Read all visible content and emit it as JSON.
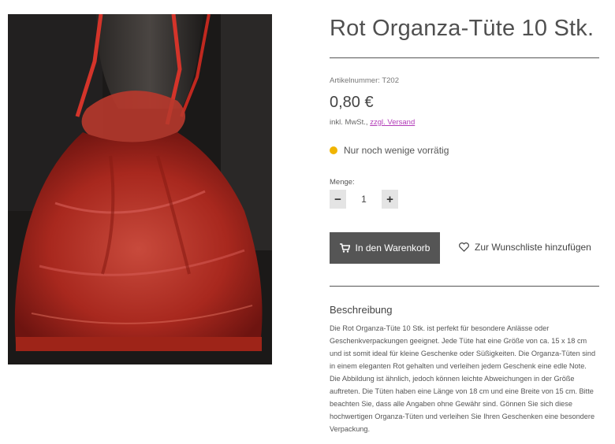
{
  "product": {
    "title": "Rot Organza-Tüte 10 Stk.",
    "sku": "Artikelnummer: T202",
    "price": "0,80 €",
    "tax_prefix": "inkl. MwSt., ",
    "shipping_link": "zzgl. Versand",
    "stock_status": "Nur noch wenige vorrätig",
    "stock_color": "#f0b400"
  },
  "quantity": {
    "label": "Menge:",
    "value": "1",
    "minus": "−",
    "plus": "+"
  },
  "actions": {
    "add_to_cart": "In den Warenkorb",
    "wishlist": "Zur Wunschliste hinzufügen"
  },
  "description": {
    "heading": "Beschreibung",
    "text": "Die Rot Organza-Tüte 10 Stk. ist perfekt für besondere Anlässe oder Geschenkverpackungen geeignet. Jede Tüte hat eine Größe von ca. 15 x 18 cm und ist somit ideal für kleine Geschenke oder Süßigkeiten. Die Organza-Tüten sind in einem eleganten Rot gehalten und verleihen jedem Geschenk eine edle Note. Die Abbildung ist ähnlich, jedoch können leichte Abweichungen in der Größe auftreten. Die Tüten haben eine Länge von 18 cm und eine Breite von 15 cm. Bitte beachten Sie, dass alle Angaben ohne Gewähr sind. Gönnen Sie sich diese hochwertigen Organza-Tüten und verleihen Sie Ihren Geschenken eine besondere Verpackung."
  }
}
